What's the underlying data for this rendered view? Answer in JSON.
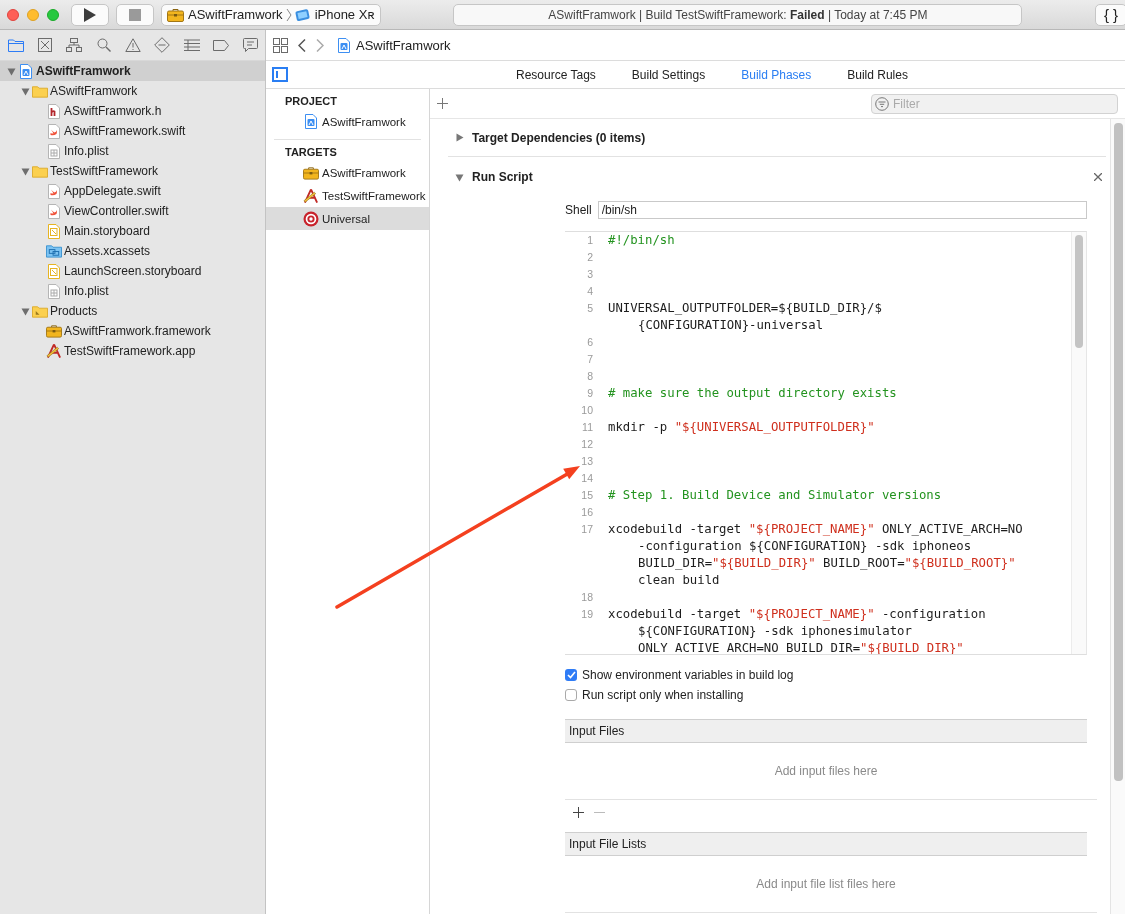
{
  "toolbar": {
    "scheme": "ASwiftFramwork",
    "device": "iPhone Xʀ",
    "activity": "ASwiftFramwork | Build TestSwiftFramework: **Failed** | Today at 7:45 PM",
    "library_button": "{ }"
  },
  "navigator": {
    "tabs": [
      {
        "selected": true
      },
      {
        "selected": false
      },
      {
        "selected": false
      },
      {
        "selected": false
      },
      {
        "selected": false
      },
      {
        "selected": false
      },
      {
        "selected": false
      },
      {
        "selected": false
      },
      {
        "selected": false
      }
    ],
    "tree": [
      {
        "label": "ASwiftFramwork",
        "kind": "project",
        "expanded": true,
        "selected": true,
        "children": [
          {
            "label": "ASwiftFramwork",
            "kind": "folder",
            "expanded": true,
            "selected": false,
            "children": [
              {
                "label": "ASwiftFramwork.h",
                "kind": "header",
                "selected": false
              },
              {
                "label": "ASwiftFramework.swift",
                "kind": "swift",
                "selected": false
              },
              {
                "label": "Info.plist",
                "kind": "plist",
                "selected": false
              }
            ]
          },
          {
            "label": "TestSwiftFramework",
            "kind": "folder",
            "expanded": true,
            "selected": false,
            "children": [
              {
                "label": "AppDelegate.swift",
                "kind": "swift",
                "selected": false
              },
              {
                "label": "ViewController.swift",
                "kind": "swift",
                "selected": false
              },
              {
                "label": "Main.storyboard",
                "kind": "storyboard",
                "selected": false
              },
              {
                "label": "Assets.xcassets",
                "kind": "assets",
                "selected": false
              },
              {
                "label": "LaunchScreen.storyboard",
                "kind": "storyboard",
                "selected": false
              },
              {
                "label": "Info.plist",
                "kind": "plist",
                "selected": false
              }
            ]
          },
          {
            "label": "Products",
            "kind": "products",
            "expanded": true,
            "selected": false,
            "children": [
              {
                "label": "ASwiftFramwork.framework",
                "kind": "framework",
                "selected": false
              },
              {
                "label": "TestSwiftFramework.app",
                "kind": "app",
                "selected": false
              }
            ]
          }
        ]
      }
    ]
  },
  "jump_bar": {
    "path": "ASwiftFramwork"
  },
  "tabs": [
    {
      "label": "Resource Tags",
      "selected": false
    },
    {
      "label": "Build Settings",
      "selected": false
    },
    {
      "label": "Build Phases",
      "selected": true
    },
    {
      "label": "Build Rules",
      "selected": false
    }
  ],
  "targets_list": [
    {
      "title": "PROJECT",
      "items": [
        {
          "label": "ASwiftFramwork",
          "kind": "project",
          "selected": false
        }
      ]
    },
    {
      "title": "TARGETS",
      "items": [
        {
          "label": "ASwiftFramwork",
          "kind": "framework",
          "selected": false
        },
        {
          "label": "TestSwiftFramework",
          "kind": "app",
          "selected": false
        },
        {
          "label": "Universal",
          "kind": "aggregate",
          "selected": true
        }
      ]
    }
  ],
  "filter": {
    "placeholder": "Filter"
  },
  "phases": [
    {
      "title": "Target Dependencies (0 items)",
      "expanded": false
    },
    {
      "title": "Run Script",
      "expanded": true,
      "shell_label": "Shell",
      "shell": "/bin/sh",
      "script": [
        {
          "n": "1",
          "rows": [
            [
              {
                "t": "#!/bin/sh",
                "kind": "comment"
              }
            ]
          ]
        },
        {
          "n": "2"
        },
        {
          "n": "3"
        },
        {
          "n": "4"
        },
        {
          "n": "5",
          "rows": [
            [
              {
                "t": "UNIVERSAL_OUTPUTFOLDER=${BUILD_DIR}/$",
                "kind": "plain"
              }
            ],
            [
              {
                "t": "{CONFIGURATION}-universal",
                "kind": "plain"
              }
            ]
          ]
        },
        {
          "n": "6"
        },
        {
          "n": "7"
        },
        {
          "n": "8"
        },
        {
          "n": "9",
          "rows": [
            [
              {
                "t": "# make sure the output directory exists",
                "kind": "comment"
              }
            ]
          ]
        },
        {
          "n": "10"
        },
        {
          "n": "11",
          "rows": [
            [
              {
                "t": "mkdir -p ",
                "kind": "plain"
              },
              {
                "t": "\"${UNIVERSAL_OUTPUTFOLDER}\"",
                "kind": "string"
              }
            ]
          ]
        },
        {
          "n": "12"
        },
        {
          "n": "13"
        },
        {
          "n": "14"
        },
        {
          "n": "15",
          "rows": [
            [
              {
                "t": "# Step 1. Build Device and Simulator versions",
                "kind": "comment"
              }
            ]
          ]
        },
        {
          "n": "16"
        },
        {
          "n": "17",
          "rows": [
            [
              {
                "t": "xcodebuild -target ",
                "kind": "plain"
              },
              {
                "t": "\"${PROJECT_NAME}\"",
                "kind": "string"
              },
              {
                "t": " ONLY_ACTIVE_ARCH=NO",
                "kind": "plain"
              }
            ],
            [
              {
                "t": "-configuration ${CONFIGURATION} -sdk iphoneos",
                "kind": "plain"
              }
            ],
            [
              {
                "t": "BUILD_DIR=",
                "kind": "plain"
              },
              {
                "t": "\"${BUILD_DIR}\"",
                "kind": "string"
              },
              {
                "t": " BUILD_ROOT=",
                "kind": "plain"
              },
              {
                "t": "\"${BUILD_ROOT}\"",
                "kind": "string"
              }
            ],
            [
              {
                "t": "clean build",
                "kind": "plain"
              }
            ]
          ]
        },
        {
          "n": "18"
        },
        {
          "n": "19",
          "rows": [
            [
              {
                "t": "xcodebuild -target ",
                "kind": "plain"
              },
              {
                "t": "\"${PROJECT_NAME}\"",
                "kind": "string"
              },
              {
                "t": " -configuration",
                "kind": "plain"
              }
            ],
            [
              {
                "t": "${CONFIGURATION} -sdk iphonesimulator",
                "kind": "plain"
              }
            ],
            [
              {
                "t": "ONLY_ACTIVE_ARCH=NO BUILD_DIR=",
                "kind": "plain"
              },
              {
                "t": "\"${BUILD_DIR}\"",
                "kind": "string"
              }
            ]
          ]
        }
      ],
      "options": [
        {
          "label": "Show environment variables in build log",
          "checked": true
        },
        {
          "label": "Run script only when installing",
          "checked": false
        }
      ],
      "file_tables": [
        {
          "title": "Input Files",
          "placeholder": "Add input files here"
        },
        {
          "title": "Input File Lists",
          "placeholder": "Add input file list files here"
        }
      ]
    }
  ],
  "annotation": {
    "kind": "arrow"
  }
}
